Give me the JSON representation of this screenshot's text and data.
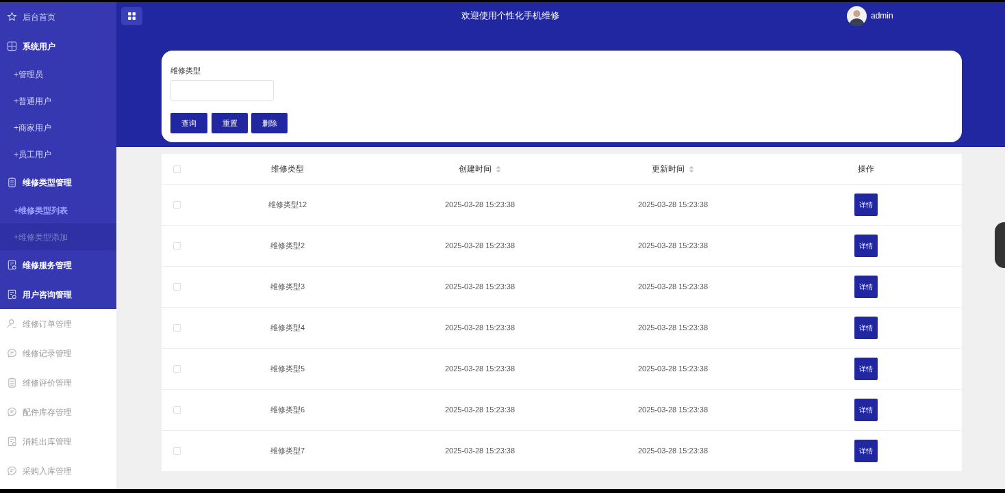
{
  "sidebar": {
    "items": [
      {
        "kind": "menu",
        "label": "后台首页",
        "active": true,
        "bold": false
      },
      {
        "kind": "menu",
        "label": "系统用户",
        "active": true,
        "bold": true
      },
      {
        "kind": "submenu",
        "label": "+管理员",
        "selected": false,
        "hovered": false
      },
      {
        "kind": "submenu",
        "label": "+普通用户",
        "selected": false,
        "hovered": false
      },
      {
        "kind": "submenu",
        "label": "+商家用户",
        "selected": false,
        "hovered": false
      },
      {
        "kind": "submenu",
        "label": "+员工用户",
        "selected": false,
        "hovered": false
      },
      {
        "kind": "menu",
        "label": "维修类型管理",
        "active": true,
        "bold": true
      },
      {
        "kind": "submenu",
        "label": "+维修类型列表",
        "selected": true,
        "hovered": false
      },
      {
        "kind": "submenu",
        "label": "+维修类型添加",
        "selected": false,
        "hovered": true
      },
      {
        "kind": "menu",
        "label": "维修服务管理",
        "active": true,
        "bold": true
      },
      {
        "kind": "menu",
        "label": "用户咨询管理",
        "active": true,
        "bold": true
      },
      {
        "kind": "menu",
        "label": "维修订单管理",
        "active": false,
        "bold": false
      },
      {
        "kind": "menu",
        "label": "维修记录管理",
        "active": false,
        "bold": false
      },
      {
        "kind": "menu",
        "label": "维修评价管理",
        "active": false,
        "bold": false
      },
      {
        "kind": "menu",
        "label": "配件库存管理",
        "active": false,
        "bold": false
      },
      {
        "kind": "menu",
        "label": "消耗出库管理",
        "active": false,
        "bold": false
      },
      {
        "kind": "menu",
        "label": "采购入库管理",
        "active": false,
        "bold": false
      }
    ]
  },
  "header": {
    "title": "欢迎使用个性化手机维修",
    "user": "admin"
  },
  "search": {
    "label": "维修类型",
    "buttons": [
      "查询",
      "重置",
      "删除"
    ]
  },
  "table": {
    "select_all": {
      "checked": false
    },
    "columns": [
      {
        "label": "维修类型",
        "sortable": false
      },
      {
        "label": "创建时间",
        "sortable": true
      },
      {
        "label": "更新时间",
        "sortable": true
      },
      {
        "label": "操作",
        "sortable": false
      }
    ],
    "rows": [
      {
        "checked": false,
        "type": "维修类型12",
        "created": "2025-03-28 15:23:38",
        "updated": "2025-03-28 15:23:38",
        "action": "详情"
      },
      {
        "checked": false,
        "type": "维修类型2",
        "created": "2025-03-28 15:23:38",
        "updated": "2025-03-28 15:23:38",
        "action": "详情"
      },
      {
        "checked": false,
        "type": "维修类型3",
        "created": "2025-03-28 15:23:38",
        "updated": "2025-03-28 15:23:38",
        "action": "详情"
      },
      {
        "checked": false,
        "type": "维修类型4",
        "created": "2025-03-28 15:23:38",
        "updated": "2025-03-28 15:23:38",
        "action": "详情"
      },
      {
        "checked": false,
        "type": "维修类型5",
        "created": "2025-03-28 15:23:38",
        "updated": "2025-03-28 15:23:38",
        "action": "详情"
      },
      {
        "checked": false,
        "type": "维修类型6",
        "created": "2025-03-28 15:23:38",
        "updated": "2025-03-28 15:23:38",
        "action": "详情"
      },
      {
        "checked": false,
        "type": "维修类型7",
        "created": "2025-03-28 15:23:38",
        "updated": "2025-03-28 15:23:38",
        "action": "详情"
      }
    ]
  }
}
